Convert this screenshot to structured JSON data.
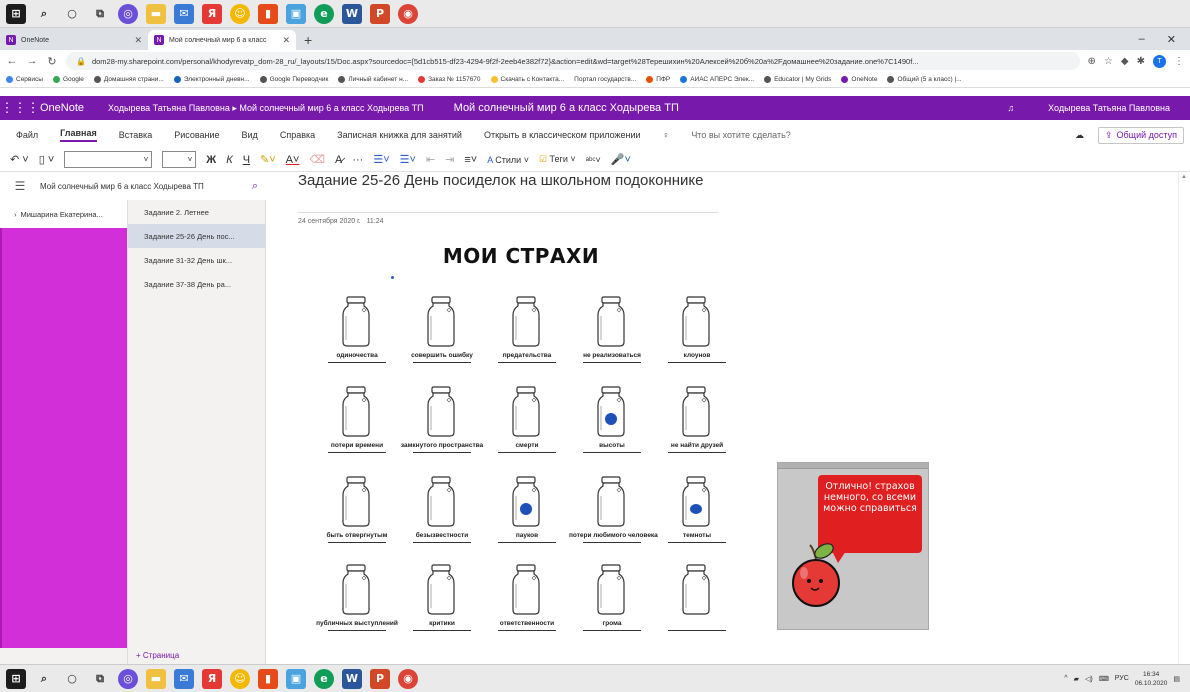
{
  "browser": {
    "tabs": [
      {
        "label": "OneNote",
        "active": false
      },
      {
        "label": "Мой солнечный мир 6 а класс",
        "active": true
      }
    ],
    "new_tab": "+",
    "url": "dom28-my.sharepoint.com/personal/khodyrevatp_dom-28_ru/_layouts/15/Doc.aspx?sourcedoc={5d1cb515-df23-4294-9f2f-2eeb4e382f72}&action=edit&wd=target%28Терешихин%20Алексей%20б%20а%2Fдомашнее%20задание.one%7C1490f...",
    "bookmarks": [
      "Сервисы",
      "Google",
      "Домашняя страни...",
      "Электронный дневн...",
      "Google Переводчик",
      "Личный кабинет н...",
      "Заказ № 1157670",
      "Скачать с Контакта...",
      "Портал государств...",
      "ПФР",
      "АИАС АПЕРС Элек...",
      "Educator | My Grids",
      "OneNote",
      "Общий (5 а класс) |..."
    ]
  },
  "onenote": {
    "app_name": "OneNote",
    "breadcrumb": "Ходырева Татьяна Павловна ▸ Мой солнечный мир 6 а класс Ходырева ТП",
    "doc_title": "Мой солнечный мир 6 а класс Ходырева ТП",
    "user_name": "Ходырева Татьяна Павловна",
    "menu": [
      "Файл",
      "Главная",
      "Вставка",
      "Рисование",
      "Вид",
      "Справка",
      "Записная книжка для занятий",
      "Открыть в классическом приложении"
    ],
    "search_placeholder": "Что вы хотите сделать?",
    "share_label": "Общий доступ",
    "toolbar": {
      "bold": "Ж",
      "italic": "К",
      "underline": "Ч",
      "styles": "Стили",
      "tags": "Теги",
      "more": "···"
    },
    "notebook_name": "Мой солнечный мир 6 а класс Ходырева ТП",
    "sections": [
      {
        "label": "Мишарина Екатерина...",
        "color": "#d32fd8"
      }
    ],
    "pages": [
      {
        "label": "Задание 2. Летнее",
        "active": false
      },
      {
        "label": "Задание 25-26 День пос...",
        "active": true
      },
      {
        "label": "Задание 31-32 День шк...",
        "active": false
      },
      {
        "label": "Задание 37-38 День ра...",
        "active": false
      }
    ],
    "add_page": "+ Страница"
  },
  "page": {
    "title": "Задание 25-26 День посиделок на школьном подоконнике",
    "date": "24 сентября 2020 г.",
    "time": "11:24",
    "worksheet_title": "МОИ СТРАХИ",
    "jars": [
      {
        "label": "одиночества",
        "filled": false
      },
      {
        "label": "совершить ошибку",
        "filled": false
      },
      {
        "label": "предательства",
        "filled": false
      },
      {
        "label": "не реализоваться",
        "filled": false
      },
      {
        "label": "клоунов",
        "filled": false
      },
      {
        "label": "потери времени",
        "filled": false
      },
      {
        "label": "замкнутого пространства",
        "filled": false
      },
      {
        "label": "смерти",
        "filled": false
      },
      {
        "label": "высоты",
        "filled": true
      },
      {
        "label": "не найти друзей",
        "filled": false
      },
      {
        "label": "быть отвергнутым",
        "filled": false
      },
      {
        "label": "безызвестности",
        "filled": false
      },
      {
        "label": "пауков",
        "filled": true
      },
      {
        "label": "потери любимого человека",
        "filled": false
      },
      {
        "label": "темноты",
        "filled": true
      },
      {
        "label": "публичных выступлений",
        "filled": false
      },
      {
        "label": "критики",
        "filled": false
      },
      {
        "label": "ответственности",
        "filled": false
      },
      {
        "label": "грома",
        "filled": false
      },
      {
        "label": "",
        "filled": false
      }
    ],
    "sticker_text": "Отлично! страхов немного, со всеми можно справиться",
    "fill_color": "#1f4fb8"
  },
  "tray": {
    "lang": "РУС",
    "time": "16:34",
    "date": "06.10.2020"
  },
  "colors": {
    "onenote_purple": "#7719aa",
    "section_magenta": "#d32fd8",
    "sticker_red": "#e02020"
  }
}
